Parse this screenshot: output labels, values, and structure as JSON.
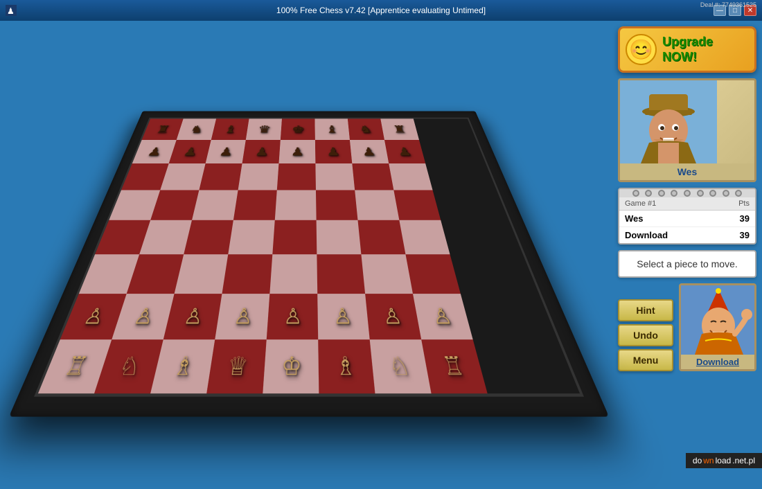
{
  "titleBar": {
    "title": "100% Free Chess v7.42 [Apprentice evaluating Untimed]",
    "dealNumber": "Deal #: 7749361525",
    "controls": {
      "minimize": "—",
      "maximize": "□",
      "close": "✕"
    }
  },
  "upgrade": {
    "smiley": "😊",
    "line1": "Upgrade",
    "line2": "NOW!"
  },
  "opponent": {
    "name": "Wes"
  },
  "scorePanel": {
    "gameLabel": "Game #1",
    "ptsLabel": "Pts",
    "rows": [
      {
        "player": "Wes",
        "score": "39"
      },
      {
        "player": "Download",
        "score": "39"
      }
    ]
  },
  "statusMessage": "Select a piece to move.",
  "actionButtons": [
    {
      "label": "Hint"
    },
    {
      "label": "Undo"
    },
    {
      "label": "Menu"
    }
  ],
  "playerAvatar": {
    "name": "Download"
  },
  "watermark": {
    "prefix": "do",
    "highlight": "wn",
    "suffix": "load",
    "domain": ".net.pl"
  }
}
